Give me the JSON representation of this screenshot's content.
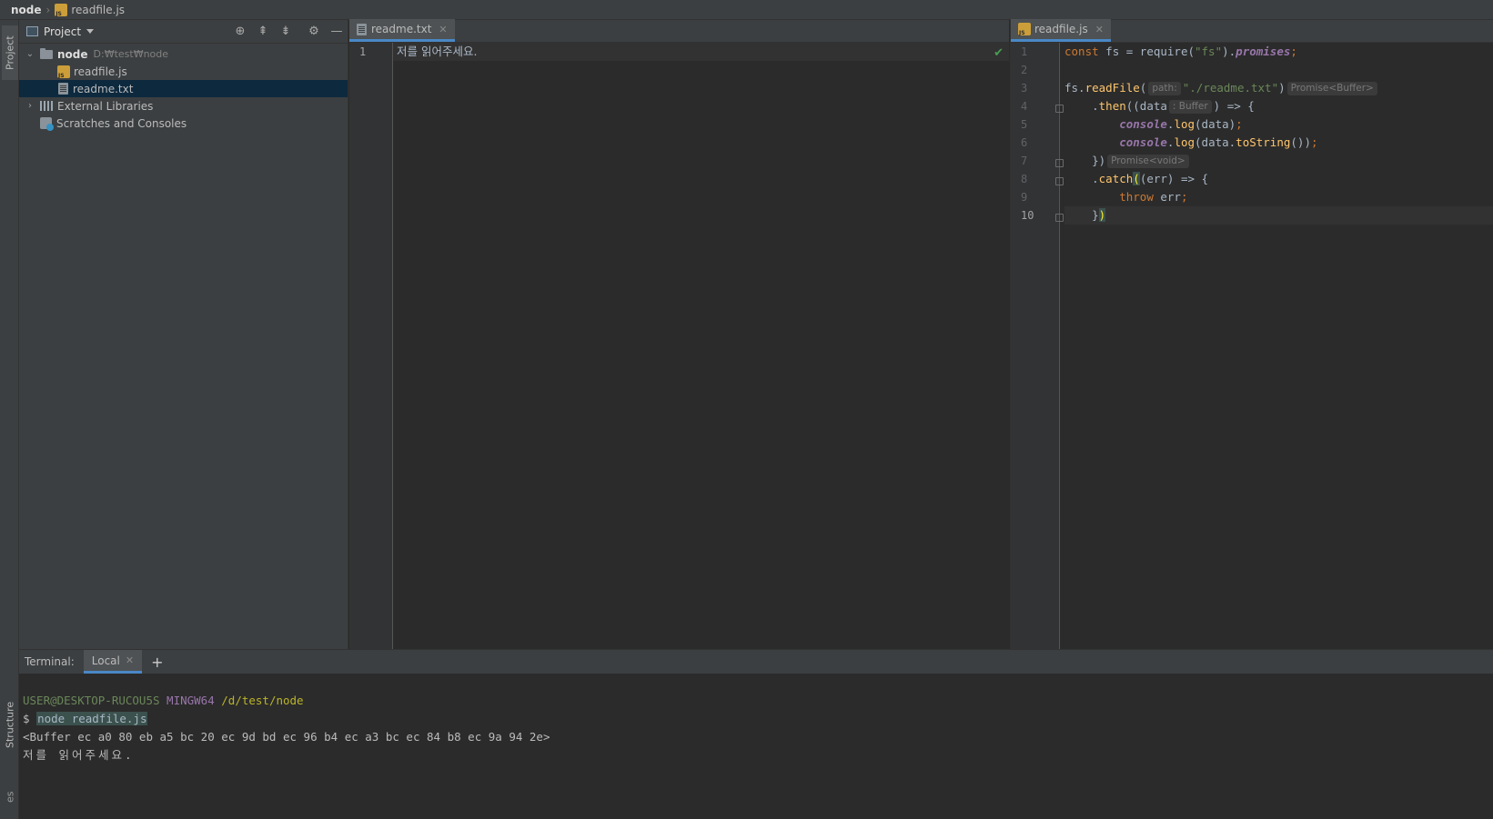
{
  "breadcrumb": {
    "root": "node",
    "file": "readfile.js"
  },
  "sidebar": {
    "project_tab": "Project",
    "structure_tab": "Structure",
    "favorites_tab": "es"
  },
  "project_panel": {
    "title": "Project",
    "root": {
      "name": "node",
      "path": "D:₩test₩node"
    },
    "files": [
      {
        "name": "readfile.js",
        "type": "js"
      },
      {
        "name": "readme.txt",
        "type": "txt",
        "selected": true
      }
    ],
    "external_libraries": "External Libraries",
    "scratches": "Scratches and Consoles"
  },
  "editor_left": {
    "tab": "readme.txt",
    "lines": [
      "저를 읽어주세요."
    ],
    "line_numbers": [
      "1"
    ]
  },
  "editor_right": {
    "tab": "readfile.js",
    "line_numbers": [
      "1",
      "2",
      "3",
      "4",
      "5",
      "6",
      "7",
      "8",
      "9",
      "10"
    ],
    "hints": {
      "path": "path:",
      "buffer": ": Buffer",
      "promise_buffer": "Promise<Buffer>",
      "promise_void": "Promise<void>"
    }
  },
  "terminal": {
    "label": "Terminal:",
    "tab": "Local",
    "prompt_user": "USER@DESKTOP-RUCOU5S",
    "prompt_host": "MINGW64",
    "prompt_path": "/d/test/node",
    "command": "node readfile.js",
    "output_buffer": "<Buffer ec a0 80 eb a5 bc 20 ec 9d bd ec 96 b4 ec a3 bc ec 84 b8 ec 9a 94 2e>",
    "output_text": "저를 읽어주세요."
  }
}
